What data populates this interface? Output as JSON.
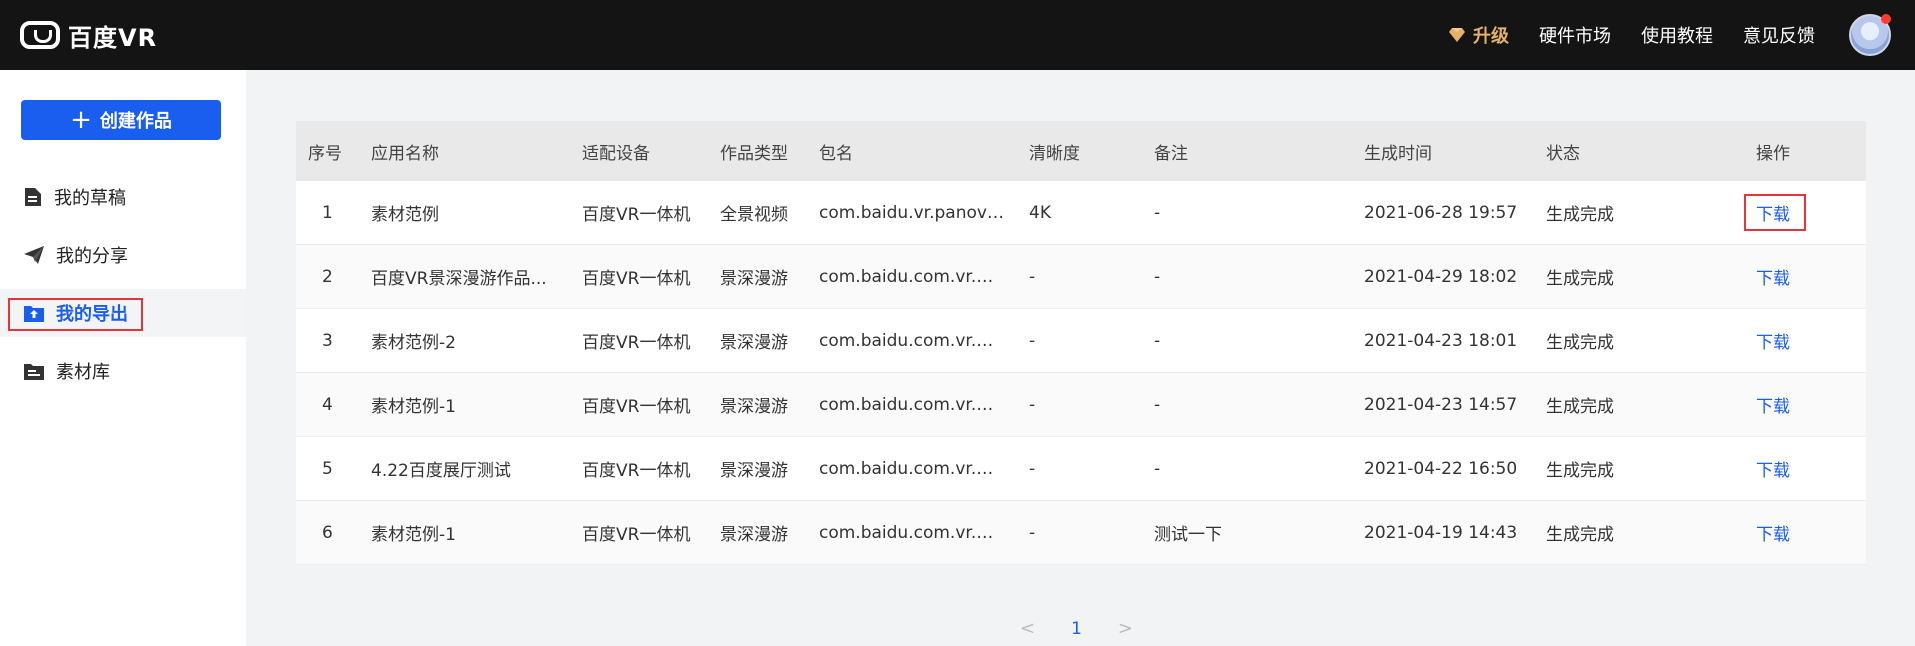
{
  "header": {
    "logo_text": "百度VR",
    "upgrade_label": "升级",
    "links": [
      "硬件市场",
      "使用教程",
      "意见反馈"
    ],
    "accent_color": "#e6b16a"
  },
  "sidebar": {
    "create_label": "创建作品",
    "items": [
      {
        "label": "我的草稿",
        "icon": "document-icon"
      },
      {
        "label": "我的分享",
        "icon": "send-icon"
      },
      {
        "label": "我的导出",
        "icon": "export-icon",
        "active": true
      },
      {
        "label": "素材库",
        "icon": "library-icon"
      }
    ],
    "brand_color": "#1a5ef0"
  },
  "table": {
    "columns": [
      "序号",
      "应用名称",
      "适配设备",
      "作品类型",
      "包名",
      "清晰度",
      "备注",
      "生成时间",
      "状态",
      "操作"
    ],
    "rows": [
      [
        "1",
        "素材范例",
        "百度VR一体机",
        "全景视频",
        "com.baidu.vr.panovid...",
        "4K",
        "-",
        "2021-06-28 19:57",
        "生成完成",
        "下载"
      ],
      [
        "2",
        "百度VR景深漫游作品...",
        "百度VR一体机",
        "景深漫游",
        "com.baidu.com.vr.de...",
        "-",
        "-",
        "2021-04-29 18:02",
        "生成完成",
        "下载"
      ],
      [
        "3",
        "素材范例-2",
        "百度VR一体机",
        "景深漫游",
        "com.baidu.com.vr.de...",
        "-",
        "-",
        "2021-04-23 18:01",
        "生成完成",
        "下载"
      ],
      [
        "4",
        "素材范例-1",
        "百度VR一体机",
        "景深漫游",
        "com.baidu.com.vr.de...",
        "-",
        "-",
        "2021-04-23 14:57",
        "生成完成",
        "下载"
      ],
      [
        "5",
        "4.22百度展厅测试",
        "百度VR一体机",
        "景深漫游",
        "com.baidu.com.vr.de...",
        "-",
        "-",
        "2021-04-22 16:50",
        "生成完成",
        "下载"
      ],
      [
        "6",
        "素材范例-1",
        "百度VR一体机",
        "景深漫游",
        "com.baidu.com.vr.de...",
        "-",
        "测试一下",
        "2021-04-19 14:43",
        "生成完成",
        "下载"
      ]
    ]
  },
  "pagination": {
    "prev": "<",
    "current": "1",
    "next": ">"
  }
}
